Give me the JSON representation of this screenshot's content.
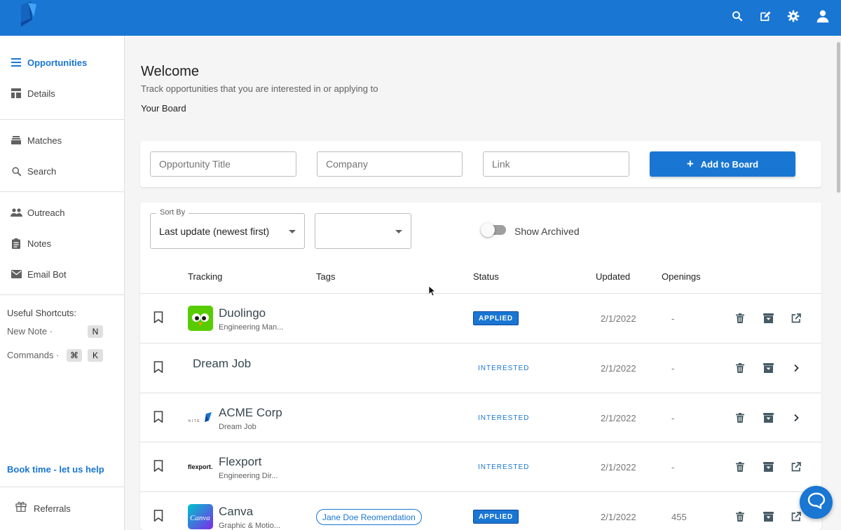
{
  "header": {
    "icons": [
      "search-icon",
      "edit-icon",
      "gear-icon",
      "user-icon"
    ],
    "brand_color": "#1976d2"
  },
  "sidebar": {
    "items": [
      {
        "label": "Opportunities",
        "icon": "menu-icon",
        "active": true
      },
      {
        "label": "Details",
        "icon": "dashboard-icon"
      },
      {
        "label": "Matches",
        "icon": "stack-icon"
      },
      {
        "label": "Search",
        "icon": "search-icon"
      },
      {
        "label": "Outreach",
        "icon": "people-icon"
      },
      {
        "label": "Notes",
        "icon": "clipboard-icon"
      },
      {
        "label": "Email Bot",
        "icon": "mail-icon"
      }
    ],
    "shortcuts": {
      "title": "Useful Shortcuts:",
      "new_note_label": "New Note ·",
      "new_note_key": "N",
      "commands_label": "Commands ·",
      "commands_key1": "⌘",
      "commands_key2": "K"
    },
    "book_time": "Book time - let us help",
    "referrals": "Referrals"
  },
  "main": {
    "title": "Welcome",
    "subtitle": "Track opportunities that you are interested in or applying to",
    "board_label": "Your Board",
    "add_form": {
      "title_placeholder": "Opportunity Title",
      "company_placeholder": "Company",
      "link_placeholder": "Link",
      "add_button": "Add to Board"
    },
    "filters": {
      "sort_label": "Sort By",
      "sort_value": "Last update (newest first)",
      "second_value": "",
      "show_archived": "Show Archived",
      "show_archived_on": false
    },
    "columns": {
      "tracking": "Tracking",
      "tags": "Tags",
      "status": "Status",
      "updated": "Updated",
      "openings": "Openings"
    },
    "rows": [
      {
        "name": "Duolingo",
        "role": "Engineering Man...",
        "tag": "",
        "status": "APPLIED",
        "updated": "2/1/2022",
        "openings": "-",
        "logo": "duolingo-logo",
        "action": "external-link-icon"
      },
      {
        "name": "Dream Job",
        "role": "",
        "tag": "",
        "status": "INTERESTED",
        "updated": "2/1/2022",
        "openings": "-",
        "logo": "",
        "action": "chevron-right-icon"
      },
      {
        "name": "ACME Corp",
        "role": "Dream Job",
        "tag": "",
        "status": "INTERESTED",
        "updated": "2/1/2022",
        "openings": "-",
        "logo": "kite-logo",
        "logo_text": "KITE",
        "action": "chevron-right-icon"
      },
      {
        "name": "Flexport",
        "role": "Engineering Dir...",
        "tag": "",
        "status": "INTERESTED",
        "updated": "2/1/2022",
        "openings": "-",
        "logo": "flexport-logo",
        "logo_text": "flexport.",
        "action": "external-link-icon"
      },
      {
        "name": "Canva",
        "role": "Graphic & Motio...",
        "tag": "Jane Doe Reomendation",
        "status": "APPLIED",
        "updated": "2/1/2022",
        "openings": "455",
        "logo": "canva-logo",
        "logo_text": "Canva",
        "action": "external-link-icon"
      }
    ]
  }
}
